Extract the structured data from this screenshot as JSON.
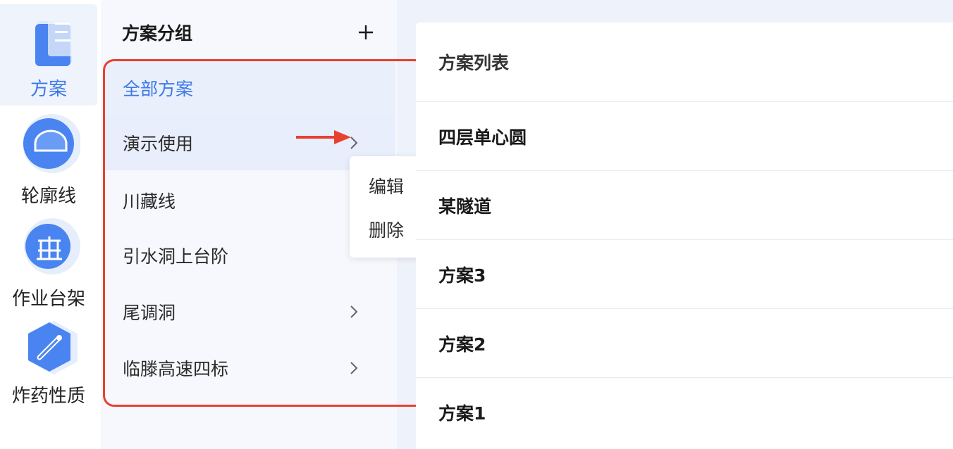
{
  "nav": {
    "items": [
      {
        "label": "方案",
        "icon": "document-list-icon"
      },
      {
        "label": "轮廓线",
        "icon": "contour-icon"
      },
      {
        "label": "作业台架",
        "icon": "work-platform-icon"
      },
      {
        "label": "炸药性质",
        "icon": "explosive-icon"
      }
    ],
    "active_color": "#3c78e8"
  },
  "groups": {
    "title": "方案分组",
    "items": [
      {
        "label": "全部方案"
      },
      {
        "label": "演示使用"
      },
      {
        "label": "川藏线"
      },
      {
        "label": "引水洞上台阶"
      },
      {
        "label": "尾调洞"
      },
      {
        "label": "临滕高速四标"
      }
    ],
    "context_menu": {
      "edit": "编辑",
      "delete": "删除"
    },
    "highlight_color": "#e84030"
  },
  "plans": {
    "title": "方案列表",
    "items": [
      {
        "label": "四层单心圆"
      },
      {
        "label": "某隧道"
      },
      {
        "label": "方案3"
      },
      {
        "label": "方案2"
      },
      {
        "label": "方案1"
      }
    ]
  }
}
